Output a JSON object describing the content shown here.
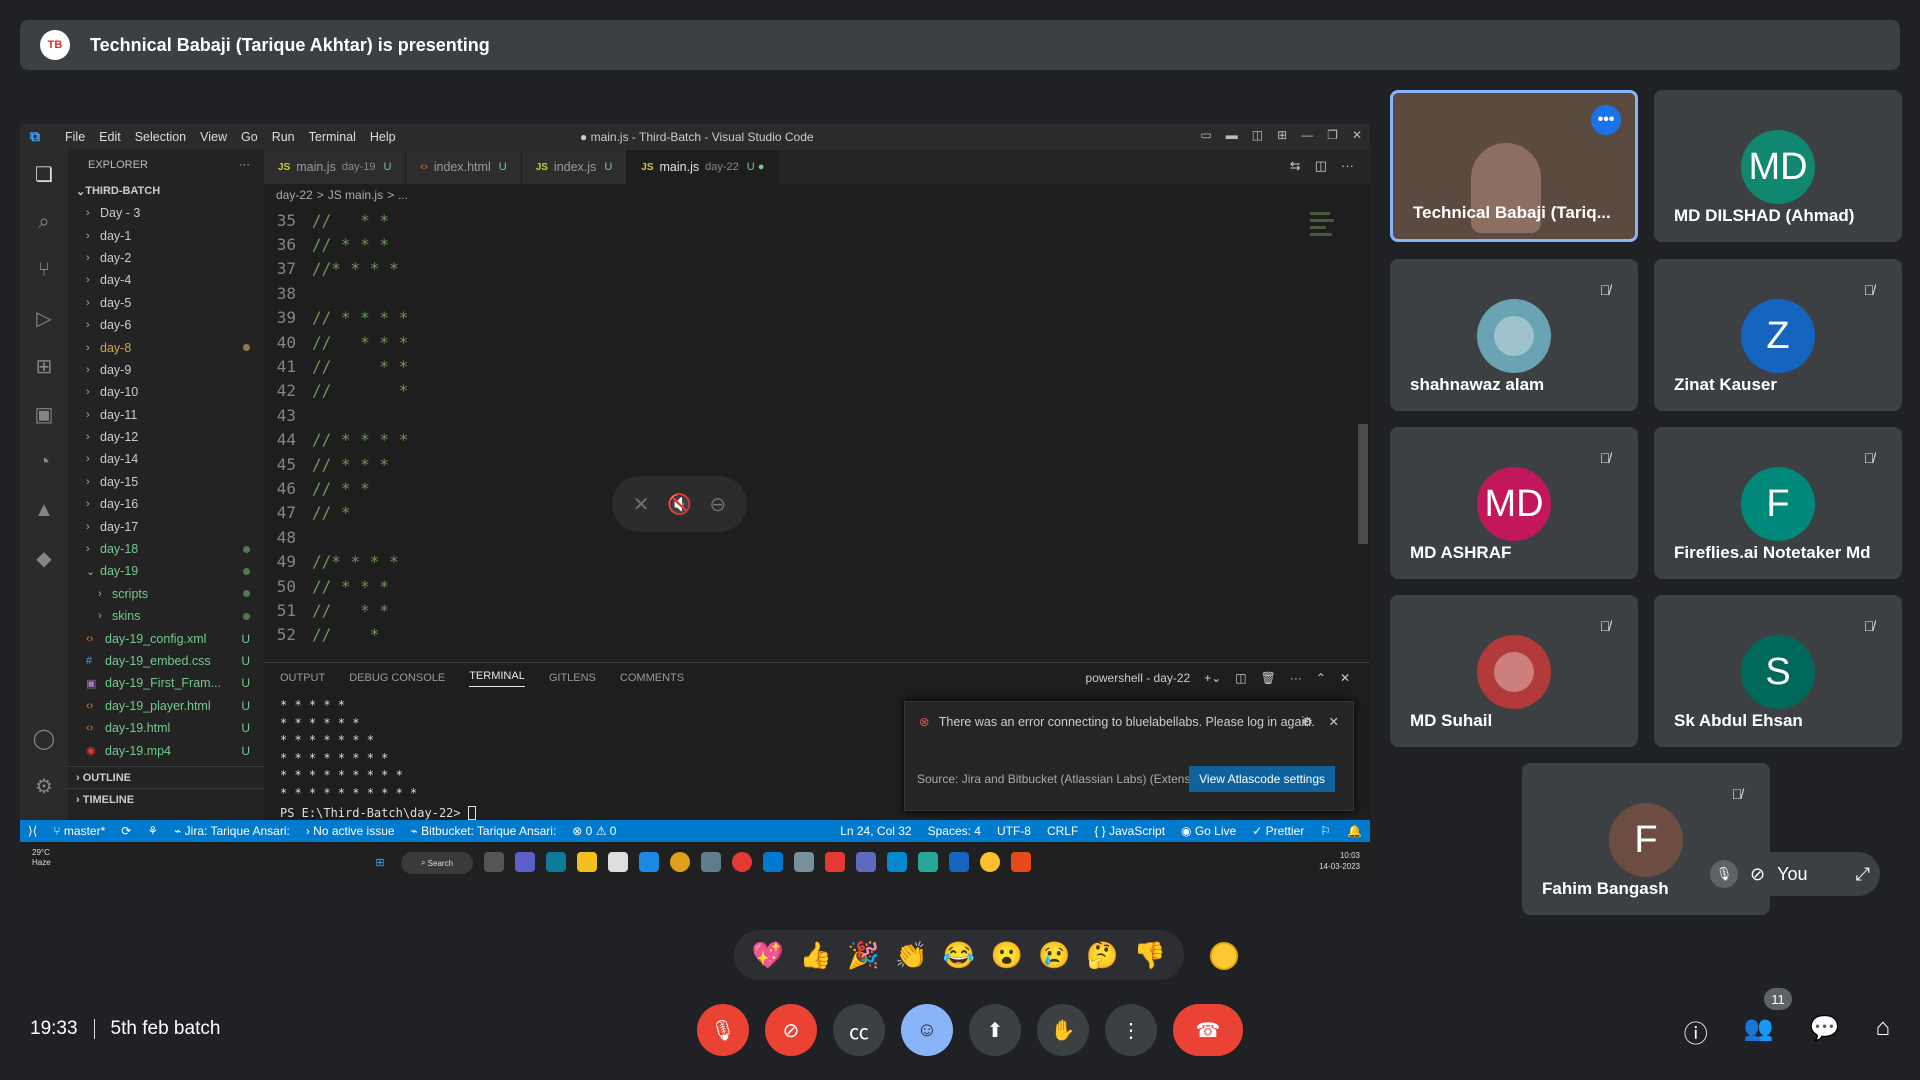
{
  "banner": {
    "logo_text": "TB",
    "presenting": "Technical Babaji (Tarique Akhtar) is presenting"
  },
  "vscode": {
    "menu": [
      "File",
      "Edit",
      "Selection",
      "View",
      "Go",
      "Run",
      "Terminal",
      "Help"
    ],
    "title": "● main.js - Third-Batch - Visual Studio Code",
    "explorer_label": "EXPLORER",
    "folder": "THIRD-BATCH",
    "tree": [
      {
        "name": "Day - 3",
        "type": "folder"
      },
      {
        "name": "day-1",
        "type": "folder"
      },
      {
        "name": "day-2",
        "type": "folder"
      },
      {
        "name": "day-4",
        "type": "folder"
      },
      {
        "name": "day-5",
        "type": "folder"
      },
      {
        "name": "day-6",
        "type": "folder"
      },
      {
        "name": "day-8",
        "type": "folder",
        "status": "modified"
      },
      {
        "name": "day-9",
        "type": "folder"
      },
      {
        "name": "day-10",
        "type": "folder"
      },
      {
        "name": "day-11",
        "type": "folder"
      },
      {
        "name": "day-12",
        "type": "folder"
      },
      {
        "name": "day-14",
        "type": "folder"
      },
      {
        "name": "day-15",
        "type": "folder"
      },
      {
        "name": "day-16",
        "type": "folder"
      },
      {
        "name": "day-17",
        "type": "folder"
      },
      {
        "name": "day-18",
        "type": "folder",
        "status": "untracked"
      },
      {
        "name": "day-19",
        "type": "folder-open",
        "status": "untracked"
      },
      {
        "name": "scripts",
        "type": "subfolder",
        "status": "untracked"
      },
      {
        "name": "skins",
        "type": "subfolder",
        "status": "untracked"
      },
      {
        "name": "day-19_config.xml",
        "type": "file",
        "icon": "xml",
        "badge": "U"
      },
      {
        "name": "day-19_embed.css",
        "type": "file",
        "icon": "css",
        "badge": "U"
      },
      {
        "name": "day-19_First_Fram...",
        "type": "file",
        "icon": "img",
        "badge": "U"
      },
      {
        "name": "day-19_player.html",
        "type": "file",
        "icon": "html",
        "badge": "U"
      },
      {
        "name": "day-19.html",
        "type": "file",
        "icon": "html",
        "badge": "U"
      },
      {
        "name": "day-19.mp4",
        "type": "file",
        "icon": "mp4",
        "badge": "U"
      }
    ],
    "outline": "OUTLINE",
    "timeline": "TIMELINE",
    "tabs": [
      {
        "name": "main.js",
        "meta": "day-19",
        "badge": "U",
        "kind": "js"
      },
      {
        "name": "index.html",
        "meta": "",
        "badge": "U",
        "kind": "html"
      },
      {
        "name": "index.js",
        "meta": "",
        "badge": "U",
        "kind": "js"
      },
      {
        "name": "main.js",
        "meta": "day-22",
        "badge": "U ●",
        "kind": "js",
        "active": true
      }
    ],
    "breadcrumb": [
      "day-22",
      ">",
      "JS main.js",
      ">",
      "..."
    ],
    "code": [
      {
        "n": "35",
        "t": "//   * *"
      },
      {
        "n": "36",
        "t": "// * * *"
      },
      {
        "n": "37",
        "t": "//* * * *"
      },
      {
        "n": "38",
        "t": ""
      },
      {
        "n": "39",
        "t": "// * * * *"
      },
      {
        "n": "40",
        "t": "//   * * *"
      },
      {
        "n": "41",
        "t": "//     * *"
      },
      {
        "n": "42",
        "t": "//       *"
      },
      {
        "n": "43",
        "t": ""
      },
      {
        "n": "44",
        "t": "// * * * *"
      },
      {
        "n": "45",
        "t": "// * * *"
      },
      {
        "n": "46",
        "t": "// * *"
      },
      {
        "n": "47",
        "t": "// *"
      },
      {
        "n": "48",
        "t": ""
      },
      {
        "n": "49",
        "t": "//* * * *"
      },
      {
        "n": "50",
        "t": "// * * *"
      },
      {
        "n": "51",
        "t": "//   * *"
      },
      {
        "n": "52",
        "t": "//    *"
      }
    ],
    "panel_tabs": [
      "OUTPUT",
      "DEBUG CONSOLE",
      "TERMINAL",
      "GITLENS",
      "COMMENTS"
    ],
    "panel_shell": "powershell - day-22",
    "terminal": [
      "* * * * *",
      "* * * * * *",
      "* * * * * * *",
      "* * * * * * * *",
      "* * * * * * * * *",
      "* * * * * * * * * *"
    ],
    "prompt": "PS E:\\Third-Batch\\day-22> ",
    "notification": {
      "message": "There was an error connecting to bluelabellabs. Please log in again.",
      "source": "Source: Jira and Bitbucket (Atlassian Labs) (Extensi...",
      "button": "View Atlascode settings"
    },
    "status": {
      "branch": "master*",
      "jira": "Jira: Tarique Ansari:",
      "issue": "No active issue",
      "bitbucket": "Bitbucket: Tarique Ansari:",
      "problems": "⊗ 0 ⚠ 0",
      "position": "Ln 24, Col 32",
      "spaces": "Spaces: 4",
      "encoding": "UTF-8",
      "eol": "CRLF",
      "language": "JavaScript",
      "golive": "Go Live",
      "prettier": "✓ Prettier"
    },
    "taskbar": {
      "weather": "29°C",
      "weather_desc": "Haze",
      "search": "Search",
      "time": "10:03",
      "date": "14-03-2023"
    }
  },
  "participants": [
    {
      "name": "Technical Babaji (Tariq...",
      "avatar": "",
      "color": "#5a4a40",
      "presenter": true
    },
    {
      "name": "MD DILSHAD (Ahmad)",
      "avatar": "MD",
      "color": "#12876f"
    },
    {
      "name": "shahnawaz alam",
      "avatar": "",
      "color": "#6aa3b3",
      "muted": true
    },
    {
      "name": "Zinat Kauser",
      "avatar": "Z",
      "color": "#1565c0",
      "muted": true
    },
    {
      "name": "MD ASHRAF",
      "avatar": "MD",
      "color": "#c2185b",
      "muted": true
    },
    {
      "name": "Fireflies.ai Notetaker Md",
      "avatar": "F",
      "color": "#00897b",
      "muted": true
    },
    {
      "name": "MD Suhail",
      "avatar": "",
      "color": "#b33a3a",
      "muted": true
    },
    {
      "name": "Sk Abdul Ehsan",
      "avatar": "S",
      "color": "#00695c",
      "muted": true
    },
    {
      "name": "Fahim Bangash",
      "avatar": "F",
      "color": "#6d4c41",
      "muted": true
    }
  ],
  "self": {
    "label": "You"
  },
  "reactions": [
    "💖",
    "👍",
    "🎉",
    "👏",
    "😂",
    "😮",
    "😢",
    "🤔",
    "👎"
  ],
  "meeting": {
    "time": "19:33",
    "name": "5th feb batch",
    "people_count": "11"
  },
  "colors": {
    "accent": "#8ab4f8",
    "danger": "#ea4335",
    "vscode_blue": "#007acc"
  }
}
